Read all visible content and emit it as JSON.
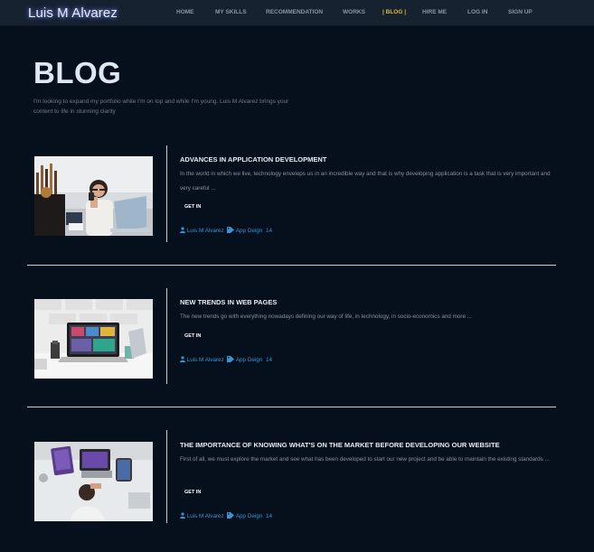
{
  "header": {
    "brand": "Luis M Alvarez",
    "nav": [
      {
        "label": "HOME",
        "active": false
      },
      {
        "label": "MY SKILLS",
        "active": false
      },
      {
        "label": "RECOMMENDATION",
        "active": false
      },
      {
        "label": "WORKS",
        "active": false
      },
      {
        "label": "| BLOG |",
        "active": true
      },
      {
        "label": "HIRE ME",
        "active": false
      },
      {
        "label": "LOG IN",
        "active": false
      },
      {
        "label": "SIGN UP",
        "active": false
      }
    ]
  },
  "page": {
    "title": "BLOG",
    "subtitle": "I'm looking to expand my portfolio while I'm on top and while I'm young. Luis M Alvarez brings your content to life in stunning clarity"
  },
  "posts": [
    {
      "title": "ADVANCES IN APPLICATION DEVELOPMENT",
      "excerpt": "In the world in which we live, technology envelops us in an incredible way and that is why developing application is a task that is very important and very careful ...",
      "cta": "GET IN",
      "author": "Luis M Alvarez",
      "category": "App Deign",
      "count": "14",
      "image": "woman-with-laptop-photo"
    },
    {
      "title": "NEW TRENDS IN WEB PAGES",
      "excerpt": "The new trends go with everything nowadays defining our way of life, in technology, in socio-economics and more ...",
      "cta": "GET IN",
      "author": "Luis M Alvarez",
      "category": "App Deign",
      "count": "14",
      "image": "laptop-on-desk-photo"
    },
    {
      "title": "THE IMPORTANCE OF KNOWING WHAT'S ON THE MARKET BEFORE DEVELOPING OUR WEBSITE",
      "excerpt": "First of all, we must explore the market and see what has been developed to start our new project and be able to maintain the existing standards ...",
      "cta": "GET IN",
      "author": "Luis M Alvarez",
      "category": "App Deign",
      "count": "14",
      "image": "overhead-desk-photo"
    }
  ],
  "colors": {
    "background": "#06101c",
    "navbar": "#16222f",
    "active_nav": "#e0b53b",
    "link_blue": "#3a93d4"
  }
}
